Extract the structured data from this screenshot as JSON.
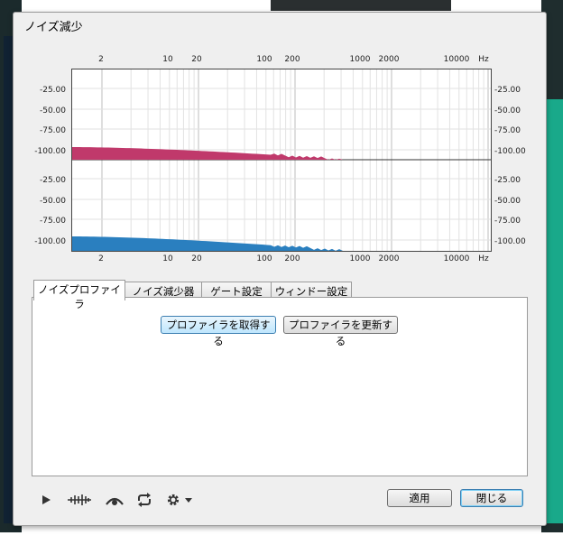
{
  "window": {
    "title": "ノイズ減少"
  },
  "graph": {
    "freq_ticks": [
      "2",
      "10",
      "20",
      "100",
      "200",
      "1000",
      "2000",
      "10000",
      "Hz"
    ],
    "db_ticks_top": [
      "-25.00",
      "-50.00",
      "-75.00",
      "-100.00"
    ],
    "db_ticks_bottom": [
      "-25.00",
      "-50.00",
      "-75.00",
      "-100.00"
    ],
    "series": [
      {
        "color": "#c0396b"
      },
      {
        "color": "#2a7fbf"
      }
    ]
  },
  "tabs": [
    "ノイズプロファイラ",
    "ノイズ減少器",
    "ゲート設定",
    "ウィンドー設定"
  ],
  "panel": {
    "get_profile": "プロファイラを取得する",
    "update_profile": "プロファイラを更新する"
  },
  "toolbar": {
    "play_icon": "play-icon",
    "waveform_icon": "waveform-icon",
    "preview_icon": "preview-icon",
    "loop_icon": "loop-icon",
    "settings_icon": "gear-icon"
  },
  "footer": {
    "apply": "適用",
    "close": "閉じる"
  }
}
